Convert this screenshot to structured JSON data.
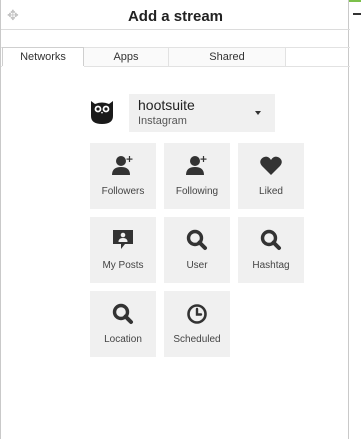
{
  "header": {
    "title": "Add a stream"
  },
  "tabs": [
    {
      "label": "Networks",
      "active": true
    },
    {
      "label": "Apps",
      "active": false
    },
    {
      "label": "Shared",
      "active": false
    }
  ],
  "account": {
    "name": "hootsuite",
    "network": "Instagram"
  },
  "streams": [
    {
      "label": "Followers",
      "icon": "add-user-icon"
    },
    {
      "label": "Following",
      "icon": "add-user-icon"
    },
    {
      "label": "Liked",
      "icon": "heart-icon"
    },
    {
      "label": "My Posts",
      "icon": "post-icon"
    },
    {
      "label": "User",
      "icon": "search-icon"
    },
    {
      "label": "Hashtag",
      "icon": "search-icon"
    },
    {
      "label": "Location",
      "icon": "search-icon"
    },
    {
      "label": "Scheduled",
      "icon": "clock-icon"
    }
  ],
  "colors": {
    "accent": "#7cc04b",
    "tile_bg": "#f0f0f0",
    "icon": "#333333"
  }
}
